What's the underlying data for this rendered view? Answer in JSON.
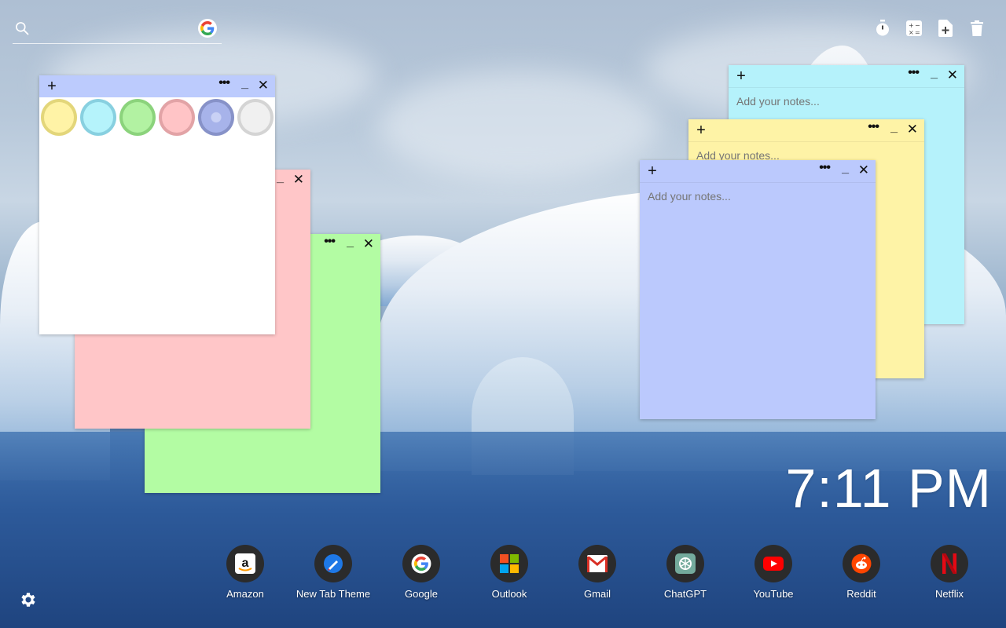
{
  "search": {
    "placeholder": "",
    "value": ""
  },
  "tools": [
    {
      "icon": "stopwatch-icon"
    },
    {
      "icon": "calculator-icon"
    },
    {
      "icon": "new-note-icon"
    },
    {
      "icon": "trash-icon"
    }
  ],
  "notes": {
    "placeholder": "Add your notes...",
    "add_label": "+",
    "more_label": "•••",
    "min_label": "_",
    "close_label": "✕"
  },
  "palette": {
    "colors": [
      {
        "name": "yellow",
        "fill": "#fff3a6",
        "ring": "#e3d67a"
      },
      {
        "name": "cyan",
        "fill": "#b5f3fb",
        "ring": "#88d0e0"
      },
      {
        "name": "green",
        "fill": "#b2f2a2",
        "ring": "#8bd37c"
      },
      {
        "name": "pink",
        "fill": "#ffc4c6",
        "ring": "#e2a3a6"
      },
      {
        "name": "blue",
        "fill": "#a7b3ea",
        "ring": "#8792c8"
      },
      {
        "name": "white",
        "fill": "#f0f0f0",
        "ring": "#d4d4d4"
      }
    ]
  },
  "note_colors": {
    "white": "#ffffff",
    "white_bar": "#bccbfd",
    "pink": "#ffc6c8",
    "green": "#b3fca3",
    "cyan": "#b5f2fb",
    "yellow": "#fef3a6",
    "blue": "#bbc9fd"
  },
  "clock": {
    "time": "7:11 PM"
  },
  "dock": [
    {
      "label": "Amazon",
      "icon": "amazon-icon"
    },
    {
      "label": "New Tab Theme",
      "icon": "new-tab-theme-icon"
    },
    {
      "label": "Google",
      "icon": "google-icon"
    },
    {
      "label": "Outlook",
      "icon": "outlook-icon"
    },
    {
      "label": "Gmail",
      "icon": "gmail-icon"
    },
    {
      "label": "ChatGPT",
      "icon": "chatgpt-icon"
    },
    {
      "label": "YouTube",
      "icon": "youtube-icon"
    },
    {
      "label": "Reddit",
      "icon": "reddit-icon"
    },
    {
      "label": "Netflix",
      "icon": "netflix-icon"
    }
  ]
}
